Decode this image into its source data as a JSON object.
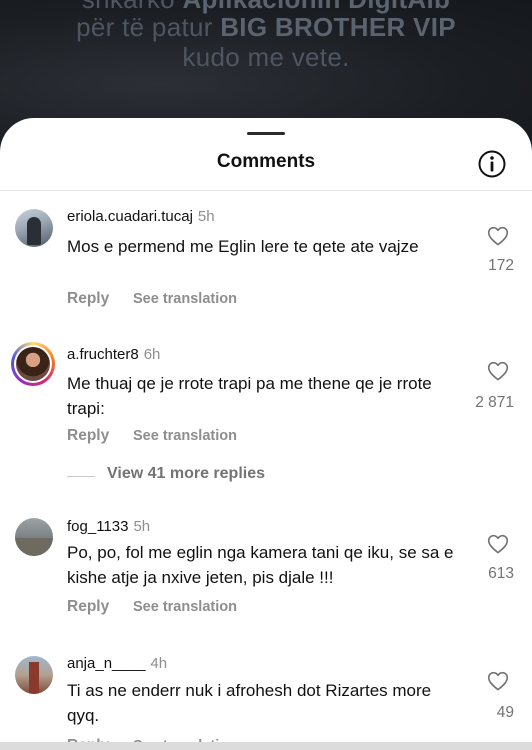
{
  "background": {
    "line1_prefix": "shkarko ",
    "line1_bold": "Aplikacionin DigitAlb",
    "line2_prefix": "për të patur ",
    "line2_bold": "BIG BROTHER VIP",
    "line3": "kudo me vete."
  },
  "sheet": {
    "title": "Comments",
    "info_icon": "info-icon"
  },
  "comments": [
    {
      "username": "eriola.cuadari.tucaj",
      "time": "5h",
      "text": "Mos e permend me Eglin lere te qete ate vajze",
      "reply": "Reply",
      "see_translation": "See translation",
      "likes": "172"
    },
    {
      "username": "a.fruchter8",
      "time": "6h",
      "text": "Me thuaj qe je rrote trapi pa me thene qe je rrote trapi:",
      "reply": "Reply",
      "see_translation": "See translation",
      "likes": "2 871",
      "view_more": "View 41 more replies"
    },
    {
      "username": "fog_1133",
      "time": "5h",
      "text": "Po, po, fol me eglin nga kamera tani qe iku, se sa e kishe atje ja nxive jeten, pis djale !!!",
      "reply": "Reply",
      "see_translation": "See translation",
      "likes": "613"
    },
    {
      "username": "anja_n____",
      "time": "4h",
      "text": "Ti as ne enderr nuk i afrohesh dot Rizartes more qyq.",
      "reply": "Reply",
      "see_translation": "See translation",
      "likes": "49"
    }
  ],
  "colors": {
    "text": "#111111",
    "secondary": "#8e8e8e",
    "sheet_bg": "#ffffff",
    "backdrop": "#1f2328"
  }
}
